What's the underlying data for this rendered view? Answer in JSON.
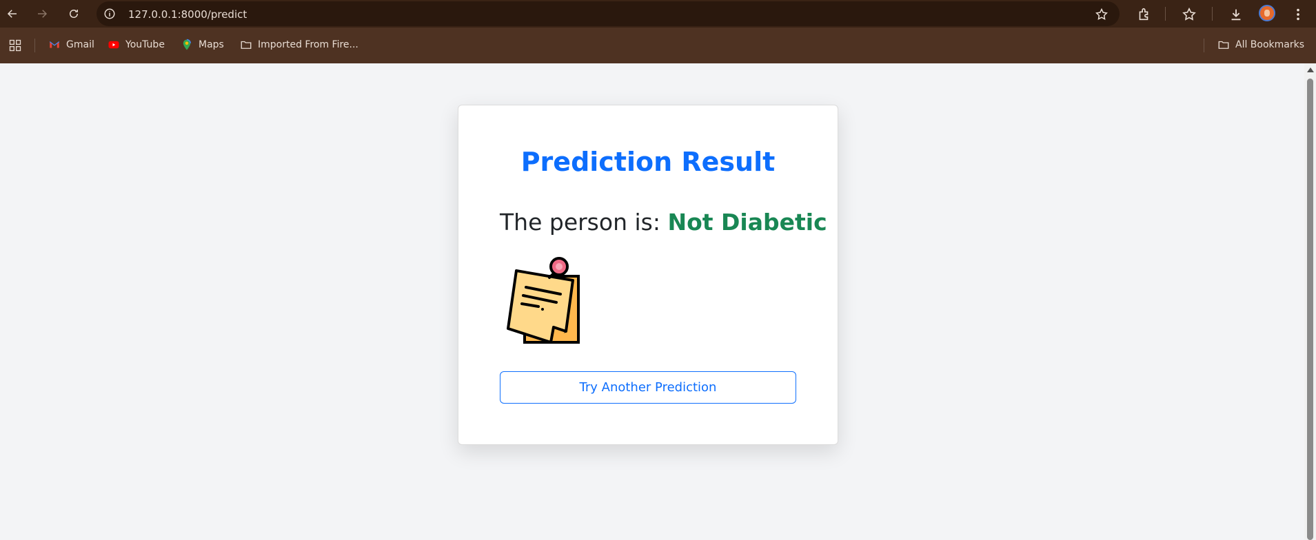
{
  "browser": {
    "url": "127.0.0.1:8000/predict",
    "bookmarks": [
      {
        "label": "Gmail",
        "icon": "gmail-icon"
      },
      {
        "label": "YouTube",
        "icon": "youtube-icon"
      },
      {
        "label": "Maps",
        "icon": "maps-icon"
      },
      {
        "label": "Imported From Fire...",
        "icon": "folder-icon"
      }
    ],
    "all_bookmarks_label": "All Bookmarks"
  },
  "result": {
    "title": "Prediction Result",
    "prefix": "The person is: ",
    "status": "Not Diabetic",
    "status_color": "#198754",
    "illustration": "sticky-note-icon",
    "button_label": "Try Another Prediction"
  },
  "colors": {
    "accent": "#0d6efd",
    "toolbar": "#3a2315",
    "bookmarks_bar": "#4e3222"
  }
}
